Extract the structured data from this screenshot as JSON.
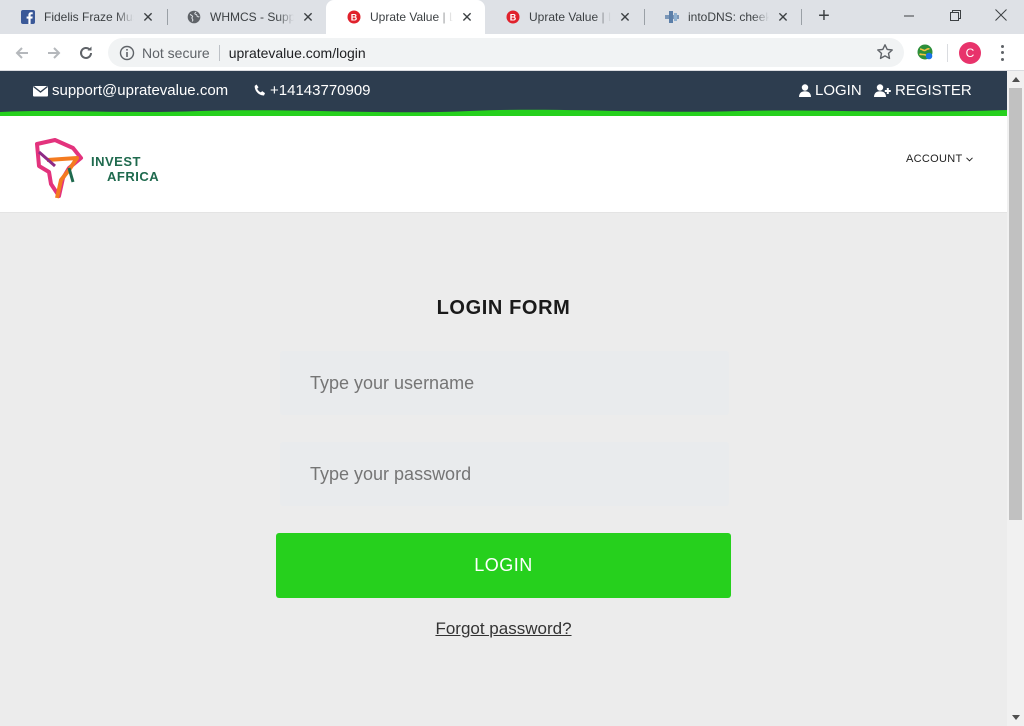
{
  "browser": {
    "tabs": [
      {
        "title": "Fidelis Fraze Musa",
        "favicon": "facebook-icon",
        "active": false
      },
      {
        "title": "WHMCS - Support",
        "favicon": "globe-icon",
        "active": false
      },
      {
        "title": "Uprate Value | Login",
        "favicon": "uprate-favicon",
        "active": true
      },
      {
        "title": "Uprate Value | Login",
        "favicon": "uprate-favicon",
        "active": false
      },
      {
        "title": "intoDNS: cheekyp",
        "favicon": "intodns-icon",
        "active": false
      }
    ],
    "security_label": "Not secure",
    "url": "upratevalue.com/login",
    "profile_initial": "C"
  },
  "site": {
    "contact": {
      "email": "support@upratevalue.com",
      "phone": "+14143770909"
    },
    "top_links": {
      "login": "LOGIN",
      "register": "REGISTER"
    },
    "logo": {
      "line1": "INVEST",
      "line2": "AFRICA"
    },
    "nav": {
      "account": "ACCOUNT"
    },
    "login_form": {
      "title": "LOGIN FORM",
      "username_placeholder": "Type your username",
      "password_placeholder": "Type your password",
      "submit_label": "LOGIN",
      "forgot_label": "Forgot password?"
    }
  },
  "colors": {
    "topbar": "#2d3d4f",
    "accent_green": "#26d01d",
    "logo_green": "#1f6a4e"
  }
}
